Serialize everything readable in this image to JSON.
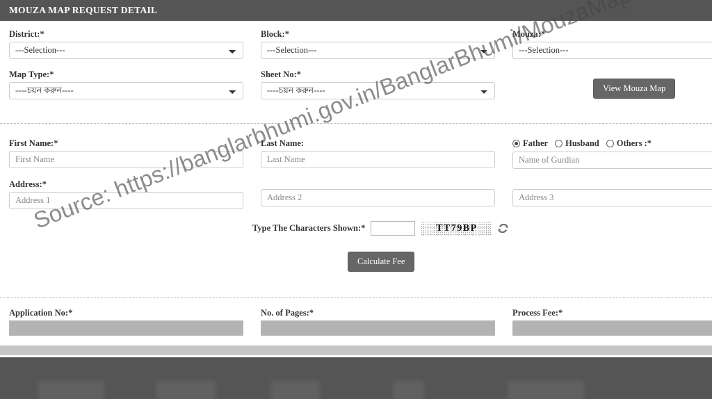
{
  "header": {
    "title": "MOUZA MAP REQUEST DETAIL"
  },
  "section_location": {
    "district": {
      "label": "District:*",
      "value": "---Selection---",
      "options": [
        "---Selection---"
      ]
    },
    "block": {
      "label": "Block:*",
      "value": "---Selection---",
      "options": [
        "---Selection---"
      ]
    },
    "mouza": {
      "label": "Mouza:*",
      "value": "---Selection---",
      "options": [
        "---Selection---"
      ]
    },
    "map_type": {
      "label": "Map Type:*",
      "value": "----চয়ন করুন----",
      "options": [
        "----চয়ন করুন----"
      ]
    },
    "sheet_no": {
      "label": "Sheet No:*",
      "value": "----চয়ন করুন----",
      "options": [
        "----চয়ন করুন----"
      ]
    },
    "view_map_button": "View Mouza Map"
  },
  "section_applicant": {
    "first_name": {
      "label": "First Name:*",
      "placeholder": "First Name",
      "value": ""
    },
    "last_name": {
      "label": "Last Name:",
      "placeholder": "Last Name",
      "value": ""
    },
    "guardian": {
      "placeholder": "Name of Gurdian",
      "value": "",
      "suffix": ":*",
      "radios": [
        {
          "label": "Father",
          "selected": true
        },
        {
          "label": "Husband",
          "selected": false
        },
        {
          "label": "Others",
          "selected": false
        }
      ]
    },
    "address": {
      "label": "Address:*",
      "line1_placeholder": "Address 1",
      "line2_placeholder": "Address 2",
      "line3_placeholder": "Address 3",
      "line1_value": "",
      "line2_value": "",
      "line3_value": ""
    },
    "captcha": {
      "label": "Type The Characters Shown:*",
      "input_value": "",
      "image_text": "TT79BP",
      "refresh_icon": "refresh-icon"
    },
    "calculate_button": "Calculate Fee"
  },
  "section_fee": {
    "application_no": {
      "label": "Application No:*",
      "value": ""
    },
    "no_of_pages": {
      "label": "No. of Pages:*",
      "value": ""
    },
    "process_fee": {
      "label": "Process Fee:*",
      "value": ""
    }
  },
  "watermark": {
    "text": "Source: https://banglarbhumi.gov.in/BanglarBhumi/MouzaMapReq.action"
  },
  "colors": {
    "header_bg": "#555555",
    "button_bg": "#666666",
    "disabled_field": "#b3b3b3",
    "gray_band": "#c6c6c6",
    "footer_bg": "#555555"
  }
}
